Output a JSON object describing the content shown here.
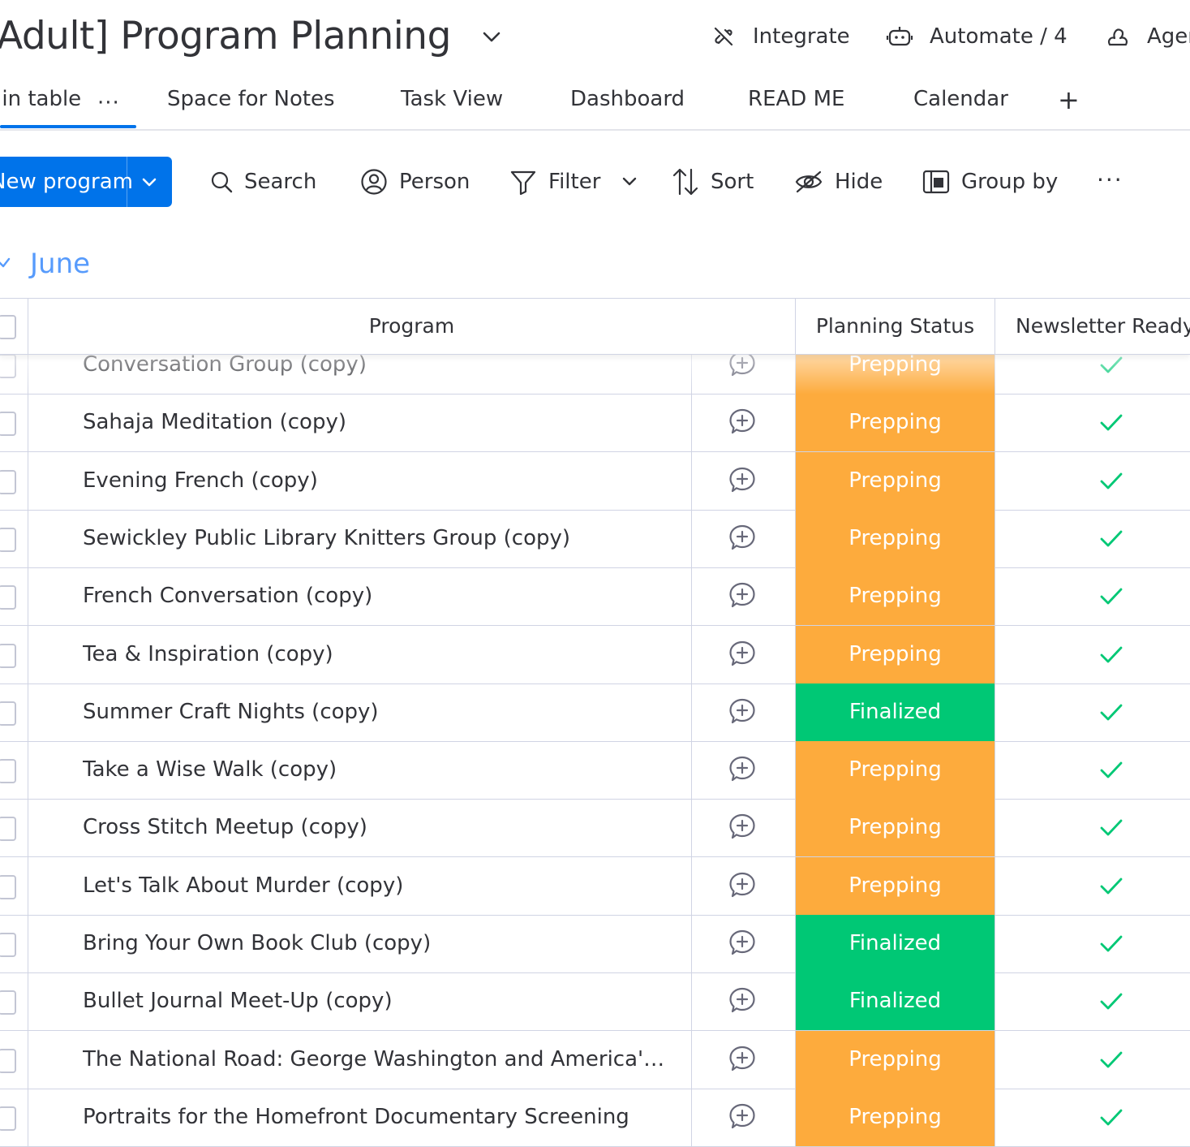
{
  "header": {
    "title": "Adult] Program Planning",
    "actions": [
      {
        "label": "Integrate",
        "icon": "integrate-icon"
      },
      {
        "label": "Automate / 4",
        "icon": "robot-icon"
      },
      {
        "label": "Agents",
        "icon": "agent-icon"
      }
    ]
  },
  "tabs": {
    "items": [
      "Main table",
      "Space for Notes",
      "Task View",
      "Dashboard",
      "READ ME",
      "Calendar"
    ],
    "more": "···",
    "add": "+"
  },
  "toolbar": {
    "new_item_label": "New program",
    "search": "Search",
    "person": "Person",
    "filter": "Filter",
    "sort": "Sort",
    "hide": "Hide",
    "group_by": "Group by",
    "more": "···"
  },
  "group": {
    "title": "June",
    "color": "#579bfc"
  },
  "table": {
    "columns": [
      "Program",
      "Planning Status",
      "Newsletter Ready"
    ],
    "status_colors": {
      "Prepping": "#fdab3d",
      "Finalized": "#00c875"
    },
    "check_color": "#00c875",
    "rows": [
      {
        "name": "Conversation Group (copy)",
        "status": "Prepping",
        "newsletter_ready": true
      },
      {
        "name": "Sahaja Meditation (copy)",
        "status": "Prepping",
        "newsletter_ready": true
      },
      {
        "name": "Evening French (copy)",
        "status": "Prepping",
        "newsletter_ready": true
      },
      {
        "name": "Sewickley Public Library Knitters Group (copy)",
        "status": "Prepping",
        "newsletter_ready": true
      },
      {
        "name": "French Conversation (copy)",
        "status": "Prepping",
        "newsletter_ready": true
      },
      {
        "name": "Tea & Inspiration (copy)",
        "status": "Prepping",
        "newsletter_ready": true
      },
      {
        "name": "Summer Craft Nights (copy)",
        "status": "Finalized",
        "newsletter_ready": true
      },
      {
        "name": "Take a Wise Walk (copy)",
        "status": "Prepping",
        "newsletter_ready": true
      },
      {
        "name": "Cross Stitch Meetup (copy)",
        "status": "Prepping",
        "newsletter_ready": true
      },
      {
        "name": "Let's Talk About Murder (copy)",
        "status": "Prepping",
        "newsletter_ready": true
      },
      {
        "name": "Bring Your Own Book Club (copy)",
        "status": "Finalized",
        "newsletter_ready": true
      },
      {
        "name": "Bullet Journal Meet-Up (copy)",
        "status": "Finalized",
        "newsletter_ready": true
      },
      {
        "name": "The National Road: George Washington and America's Fir...",
        "status": "Prepping",
        "newsletter_ready": true
      },
      {
        "name": "Portraits for the Homefront Documentary Screening",
        "status": "Prepping",
        "newsletter_ready": true
      }
    ]
  }
}
